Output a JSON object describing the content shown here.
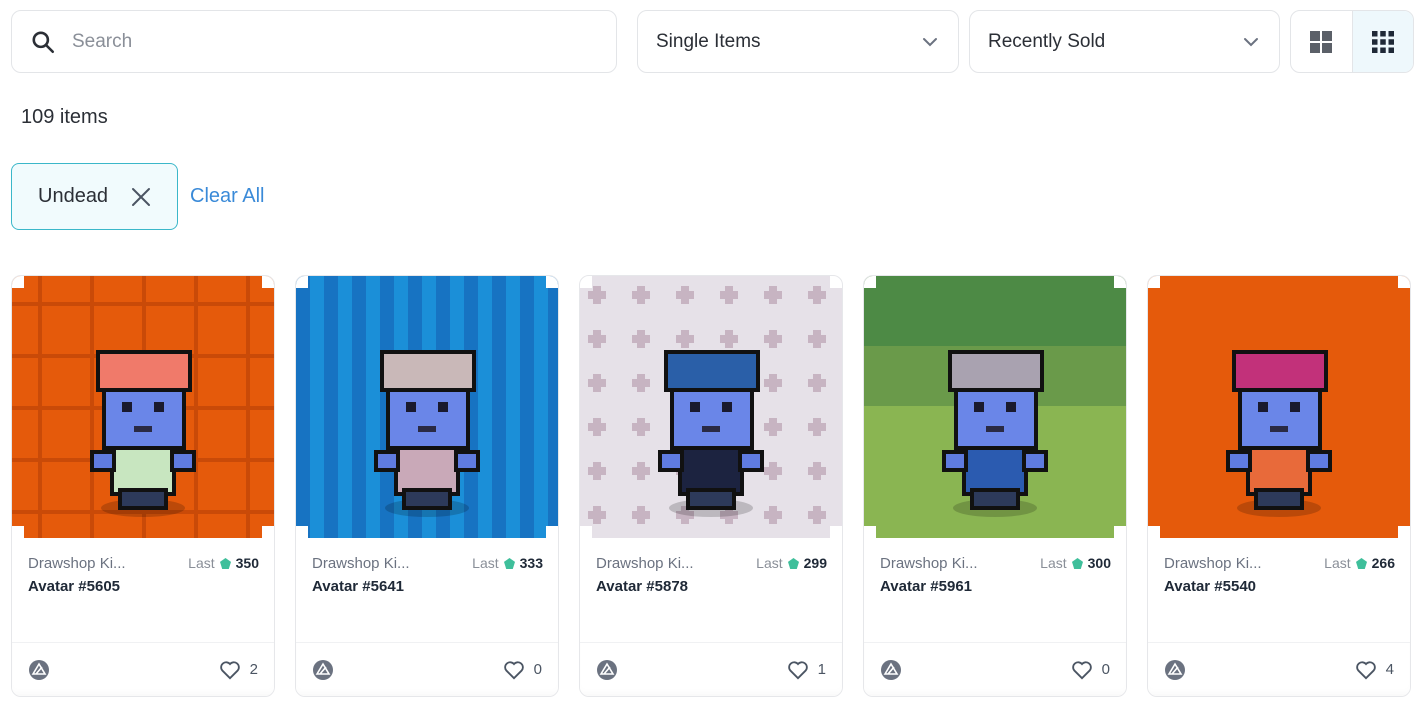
{
  "search": {
    "placeholder": "Search"
  },
  "filters": {
    "type_select": "Single Items",
    "sort_select": "Recently Sold"
  },
  "items_count": "109 items",
  "active_filters": [
    {
      "label": "Undead"
    }
  ],
  "clear_all_label": "Clear All",
  "colors": {
    "accent": "#3bb7c9",
    "link": "#3a8ad8",
    "gem": "#3fbf9b"
  },
  "cards": [
    {
      "collection": "Drawshop Ki...",
      "name": "Avatar #5605",
      "last_label": "Last",
      "price": "350",
      "likes": "2",
      "bg": "#e55a0b",
      "pattern": "grid"
    },
    {
      "collection": "Drawshop Ki...",
      "name": "Avatar #5641",
      "last_label": "Last",
      "price": "333",
      "likes": "0",
      "bg": "#1b8fd8",
      "pattern": "stripes"
    },
    {
      "collection": "Drawshop Ki...",
      "name": "Avatar #5878",
      "last_label": "Last",
      "price": "299",
      "likes": "1",
      "bg": "#e6e1e8",
      "pattern": "crosses"
    },
    {
      "collection": "Drawshop Ki...",
      "name": "Avatar #5961",
      "last_label": "Last",
      "price": "300",
      "likes": "0",
      "bg": "#6a9a4a",
      "pattern": "gradient"
    },
    {
      "collection": "Drawshop Ki...",
      "name": "Avatar #5540",
      "last_label": "Last",
      "price": "266",
      "likes": "4",
      "bg": "#e55a0b",
      "pattern": "plain"
    }
  ]
}
